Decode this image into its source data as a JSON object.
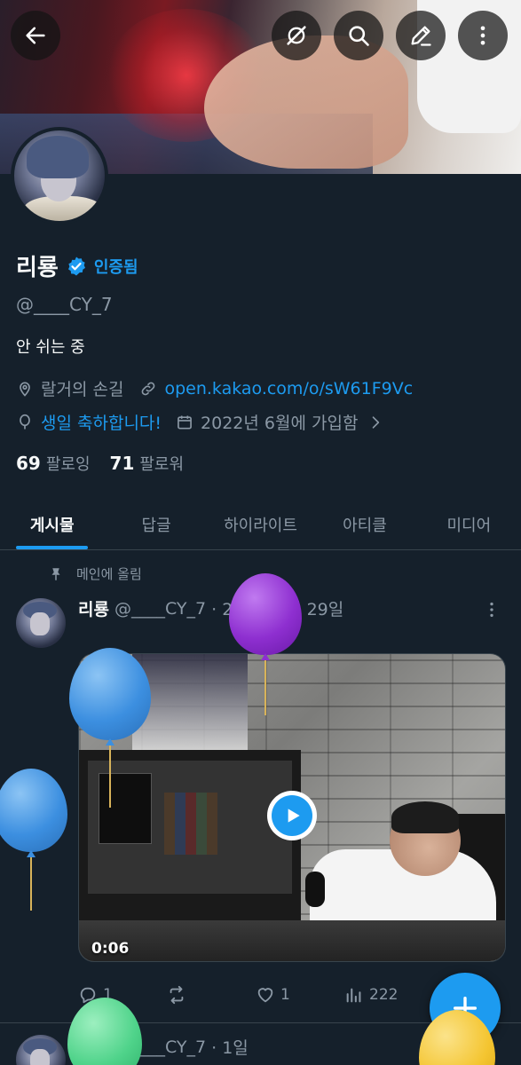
{
  "header": {
    "back_icon": "arrow-left-icon",
    "actions": [
      "pen-slash-icon",
      "search-icon",
      "edit-icon",
      "more-vertical-icon"
    ]
  },
  "profile": {
    "name": "리룡",
    "verified_label": "인증됨",
    "handle": "@____CY_7",
    "bio": "안 쉬는 중",
    "location": "랄거의 손길",
    "link": "open.kakao.com/o/sW61F9Vc",
    "birthday": "생일 축하합니다!",
    "joined": "2022년 6월에 가입함",
    "following_count": "69",
    "following_label": "팔로잉",
    "followers_count": "71",
    "followers_label": "팔로워"
  },
  "tabs": [
    {
      "label": "게시물",
      "active": true
    },
    {
      "label": "답글",
      "active": false
    },
    {
      "label": "하이라이트",
      "active": false
    },
    {
      "label": "아티클",
      "active": false
    },
    {
      "label": "미디어",
      "active": false
    }
  ],
  "pinned_post": {
    "pinned_label": "메인에 올림",
    "author": "리룡",
    "handle": "@____CY_7",
    "date": "· 25년 10월 29일",
    "video_duration": "0:06",
    "reply_count": "1",
    "retweet_count": "",
    "like_count": "1",
    "view_count": "222"
  },
  "next_post": {
    "author": "리룡",
    "handle": "@____CY_7",
    "date": "· 1일"
  },
  "colors": {
    "background": "#15202b",
    "accent": "#1d9bf0",
    "muted": "#8b98a5",
    "text": "#f7f9f9"
  },
  "balloons": [
    {
      "color": "#8e2fd0",
      "name": "purple-balloon"
    },
    {
      "color": "#3c8fe0",
      "name": "blue-balloon"
    },
    {
      "color": "#3c8fe0",
      "name": "blue-balloon-left"
    },
    {
      "color": "#4fd38a",
      "name": "green-balloon"
    },
    {
      "color": "#f4c531",
      "name": "yellow-balloon"
    }
  ]
}
